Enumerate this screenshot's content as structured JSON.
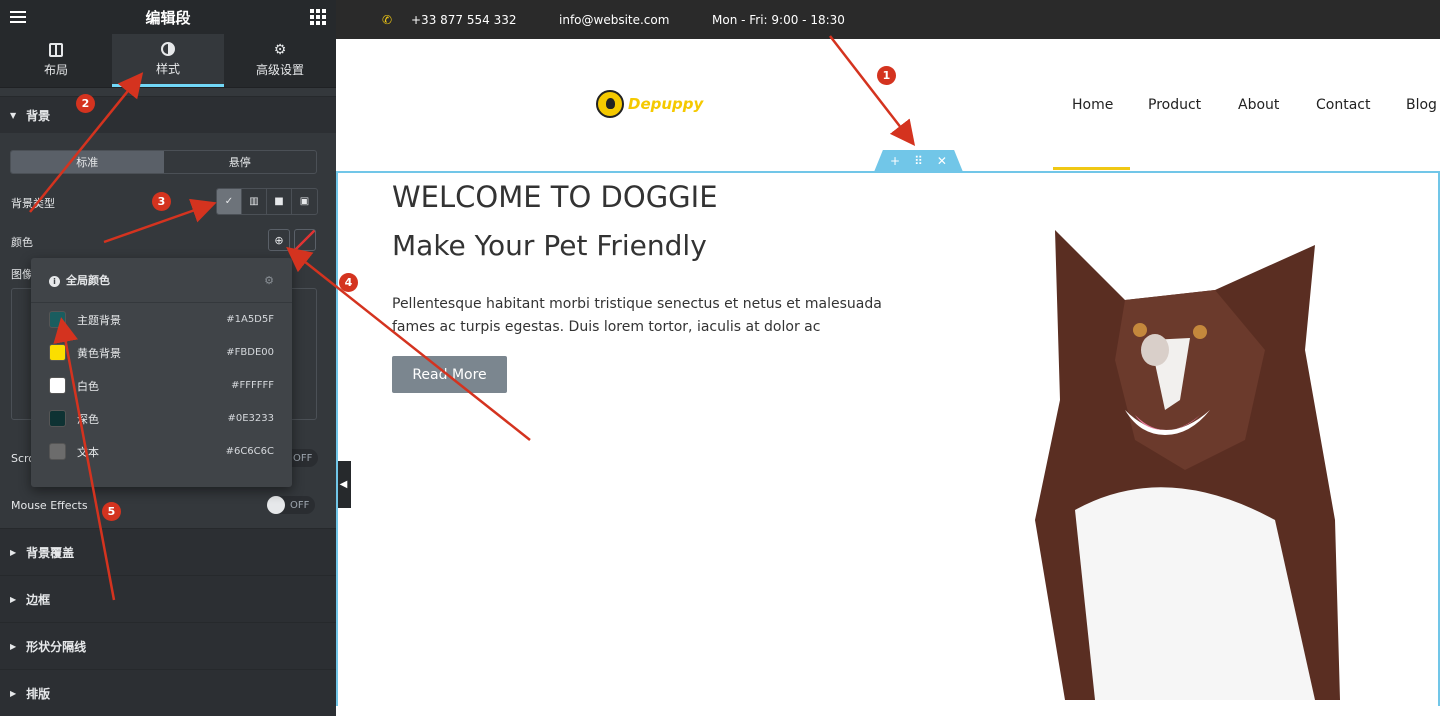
{
  "editor": {
    "title": "编辑段",
    "tabs": [
      {
        "label": "布局"
      },
      {
        "label": "样式"
      },
      {
        "label": "高级设置"
      }
    ],
    "background_section": "背景",
    "state_tabs": [
      "标准",
      "悬停"
    ],
    "bg_type_label": "背景类型",
    "color_label": "颜色",
    "image_label": "图像",
    "scroll_label": "Scro",
    "scroll_toggle": "OFF",
    "mouse_effects_label": "Mouse Effects",
    "mouse_toggle": "OFF",
    "sections": [
      "背景覆盖",
      "边框",
      "形状分隔线",
      "排版"
    ]
  },
  "global_colors": {
    "title": "全局颜色",
    "items": [
      {
        "name": "主题背景",
        "hex": "#1A5D5F",
        "color": "#1A5D5F"
      },
      {
        "name": "黄色背景",
        "hex": "#FBDE00",
        "color": "#FBDE00"
      },
      {
        "name": "白色",
        "hex": "#FFFFFF",
        "color": "#FFFFFF"
      },
      {
        "name": "深色",
        "hex": "#0E3233",
        "color": "#0E3233"
      },
      {
        "name": "文本",
        "hex": "#6C6C6C",
        "color": "#6C6C6C"
      }
    ]
  },
  "site": {
    "phone": "+33 877 554 332",
    "email": "info@website.com",
    "hours": "Mon - Fri: 9:00 - 18:30",
    "logo_text": "Depuppy",
    "nav": [
      "Home",
      "Product",
      "About",
      "Contact",
      "Blog"
    ],
    "heading": "WELCOME TO DOGGIE",
    "subheading": "Make Your Pet Friendly",
    "paragraph": "Pellentesque habitant morbi tristique senectus et netus et malesuada fames ac turpis egestas. Duis lorem tortor, iaculis at dolor ac",
    "button": "Read More"
  },
  "markers": [
    "1",
    "2",
    "3",
    "4",
    "5"
  ]
}
